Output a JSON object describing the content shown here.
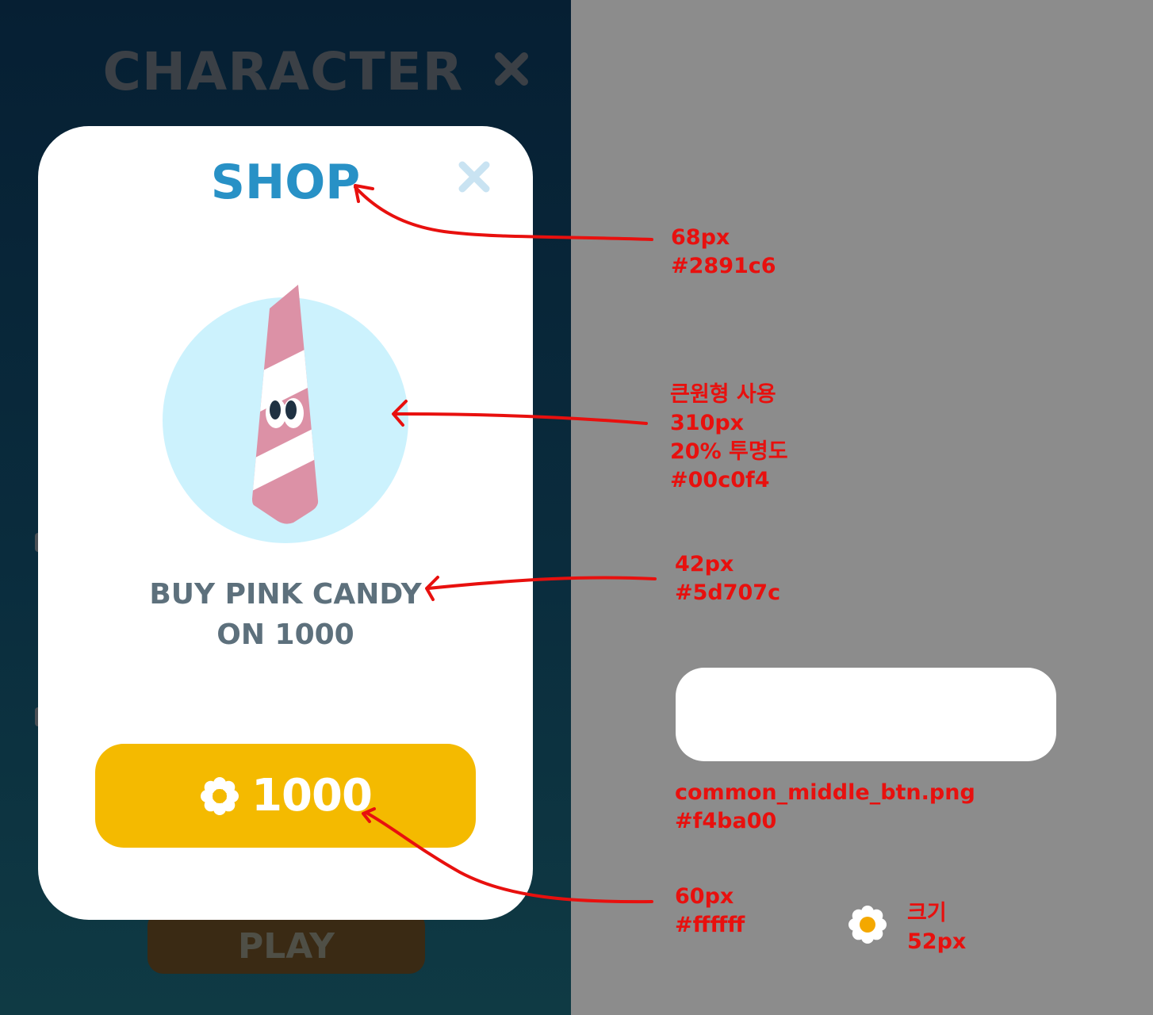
{
  "background_screen": {
    "title": "CHARACTER",
    "play_label": "PLAY"
  },
  "popup": {
    "title": "SHOP",
    "message_line1": "BUY PINK CANDY",
    "message_line2": "ON 1000",
    "buy_button": {
      "icon": "flower-icon",
      "price": "1000"
    }
  },
  "annotations": {
    "title": [
      "68px",
      "#2891c6"
    ],
    "circle": [
      "큰원형 사용",
      "310px",
      "20% 투명도",
      "#00c0f4"
    ],
    "message": [
      "42px",
      "#5d707c"
    ],
    "button": [
      "common_middle_btn.png",
      "#f4ba00"
    ],
    "price": [
      "60px",
      "#ffffff"
    ],
    "icon": [
      "크기",
      "52px"
    ]
  },
  "colors": {
    "title": "#2891c6",
    "circle": "#00c0f4",
    "message": "#5d707c",
    "button": "#f4ba00",
    "price": "#ffffff",
    "annotation": "#e8100e"
  }
}
